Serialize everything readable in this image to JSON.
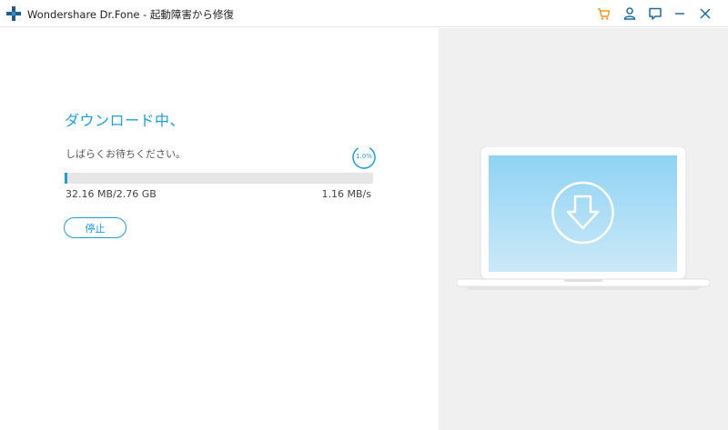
{
  "window": {
    "title": "Wondershare Dr.Fone - 起動障害から修復",
    "logo_icon": "drfone-plus-icon",
    "controls": [
      "cart-icon",
      "user-icon",
      "feedback-icon",
      "minimize-icon",
      "close-icon"
    ]
  },
  "download": {
    "heading": "ダウンロード中、",
    "message": "しばらくお待ちください。",
    "percent_label": "1.0%",
    "percent_value": 0.01,
    "downloaded": "32.16 MB/2.76 GB",
    "speed": "1.16 MB/s",
    "stop_label": "停止"
  },
  "illustration": {
    "icon": "download-arrow-icon"
  },
  "colors": {
    "accent": "#1aa0dc",
    "cart": "#f39a1e",
    "screen_top": "#8fd3f4",
    "screen_bottom": "#cbe9f8",
    "panel_bg": "#f0f0f0"
  }
}
